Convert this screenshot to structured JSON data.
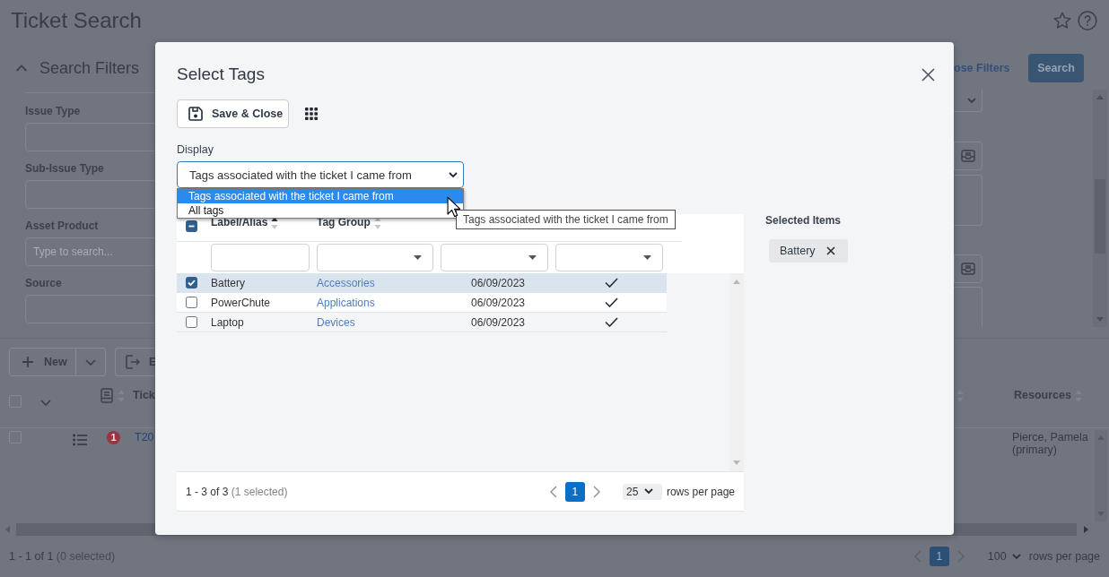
{
  "page": {
    "title": "Ticket Search"
  },
  "search_filters": {
    "title": "Search Filters",
    "expanded": true,
    "choose_filters_link": "ose Filters",
    "search_button": "Search",
    "fields": [
      {
        "label": "Issue Type"
      },
      {
        "label": "Sub-Issue Type"
      },
      {
        "label": "Asset Product",
        "placeholder": "Type to search..."
      },
      {
        "label": "Source"
      }
    ]
  },
  "toolbar": {
    "new_button": "New",
    "export_button": "E"
  },
  "results": {
    "select_all": false,
    "columns": [
      {
        "label": "Tick"
      },
      {
        "label": "Resources"
      }
    ],
    "rows": [
      {
        "checked": false,
        "priority": "1",
        "ticket": "T20",
        "resources": "Pierce, Pamela (primary)"
      }
    ],
    "footer": {
      "range": "1 - 1 of 1",
      "selected_count": "(0 selected)",
      "current_page": "1",
      "rows_per_page": "100",
      "rows_per_page_label": "rows per page"
    }
  },
  "modal": {
    "title": "Select Tags",
    "save_button": "Save & Close",
    "display": {
      "label": "Display",
      "value": "Tags associated with the ticket I came from",
      "expanded": true,
      "options": [
        {
          "label": "Tags associated with the ticket I came from",
          "selected": true
        },
        {
          "label": "All tags",
          "selected": false
        }
      ]
    },
    "tooltip": "Tags associated with the ticket I came from",
    "table": {
      "select_all": {
        "checked": false,
        "partial": true
      },
      "columns": [
        {
          "label": "Label/Alias",
          "sorted": true,
          "kind": "text"
        },
        {
          "label": "Tag Group",
          "sorted": false,
          "kind": "dropdown"
        },
        {
          "kind": "dropdown"
        },
        {
          "kind": "dropdown"
        }
      ],
      "rows": [
        {
          "selected": true,
          "label": "Battery",
          "tag_group": "Accessories",
          "column_3": "06/09/2023",
          "column_4": true
        },
        {
          "selected": false,
          "label": "PowerChute",
          "tag_group": "Applications",
          "column_3": "06/09/2023",
          "column_4": true
        },
        {
          "selected": false,
          "label": "Laptop",
          "tag_group": "Devices",
          "column_3": "06/09/2023",
          "column_4": true
        }
      ],
      "footer": {
        "range": "1 - 3 of 3",
        "selected_count": "(1 selected)",
        "current_page": "1",
        "rows_per_page": "25",
        "rows_per_page_label": "rows per page"
      }
    },
    "selected_items": {
      "title": "Selected Items",
      "items": [
        {
          "label": "Battery"
        }
      ]
    }
  }
}
